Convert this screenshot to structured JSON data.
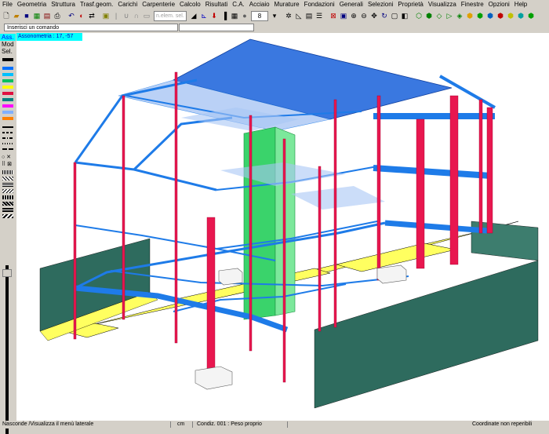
{
  "menu": [
    "File",
    "Geometria",
    "Struttura",
    "Trasf.geom.",
    "Carichi",
    "Carpenterie",
    "Calcolo",
    "Risultati",
    "C.A.",
    "Acciaio",
    "Murature",
    "Fondazioni",
    "Generali",
    "Selezioni",
    "Proprietà",
    "Visualizza",
    "Finestre",
    "Opzioni",
    "Help"
  ],
  "toolbar": {
    "elem_placeholder": "n.elem. sel.",
    "spin_value": "8"
  },
  "command": {
    "label": "Inserisci un comando",
    "value": ""
  },
  "side": {
    "ass": "Ass.",
    "mod": "Mod",
    "sel": "Sel."
  },
  "view": {
    "label": "Assonometria : 17, -57"
  },
  "colors": {
    "beam": "#1e7be8",
    "column": "#e8174f",
    "core": "#3ad36b",
    "wall": "#2e6b5e",
    "found": "#ffff40",
    "roof": "#3a78e0"
  },
  "status": {
    "left": "Nasconde /Visualizza il menù laterale",
    "unit": "cm",
    "load": "Condiz. 001 : Peso proprio",
    "coords": "Coordinate non reperibili"
  }
}
